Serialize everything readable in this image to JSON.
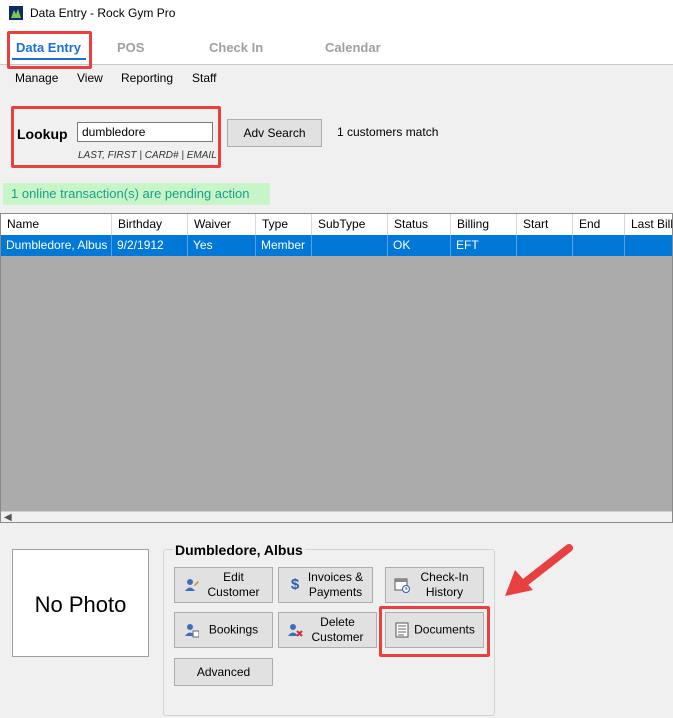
{
  "window": {
    "title": "Data Entry - Rock Gym Pro"
  },
  "main_tabs": [
    {
      "label": "Data Entry",
      "active": true
    },
    {
      "label": "POS",
      "active": false
    },
    {
      "label": "Check In",
      "active": false
    },
    {
      "label": "Calendar",
      "active": false
    }
  ],
  "submenu": [
    "Manage",
    "View",
    "Reporting",
    "Staff"
  ],
  "lookup": {
    "label": "Lookup",
    "value": "dumbledore",
    "hint": "LAST, FIRST | CARD# | EMAIL",
    "adv_search": "Adv Search",
    "match_count": "1 customers match"
  },
  "pending_notice": "1 online transaction(s) are pending action",
  "grid": {
    "columns": [
      "Name",
      "Birthday",
      "Waiver",
      "Type",
      "SubType",
      "Status",
      "Billing",
      "Start",
      "End",
      "Last Billed"
    ],
    "rows": [
      [
        "Dumbledore, Albus",
        "9/2/1912",
        "Yes",
        "Member",
        "",
        "OK",
        "EFT",
        "",
        "",
        ""
      ]
    ]
  },
  "photo": {
    "text": "No Photo"
  },
  "customer": {
    "name": "Dumbledore, Albus",
    "buttons": {
      "edit_customer": [
        "Edit",
        "Customer"
      ],
      "invoices_payments": [
        "Invoices &",
        "Payments"
      ],
      "checkin_history": [
        "Check-In",
        "History"
      ],
      "bookings": "Bookings",
      "delete_customer": [
        "Delete",
        "Customer"
      ],
      "documents": "Documents",
      "advanced": "Advanced"
    }
  },
  "colors": {
    "accent_blue": "#1d6fd8",
    "selection": "#0078d7",
    "highlight_red": "#e8403f",
    "pending_bg": "#c8f5c8",
    "pending_text": "#18a18a"
  }
}
